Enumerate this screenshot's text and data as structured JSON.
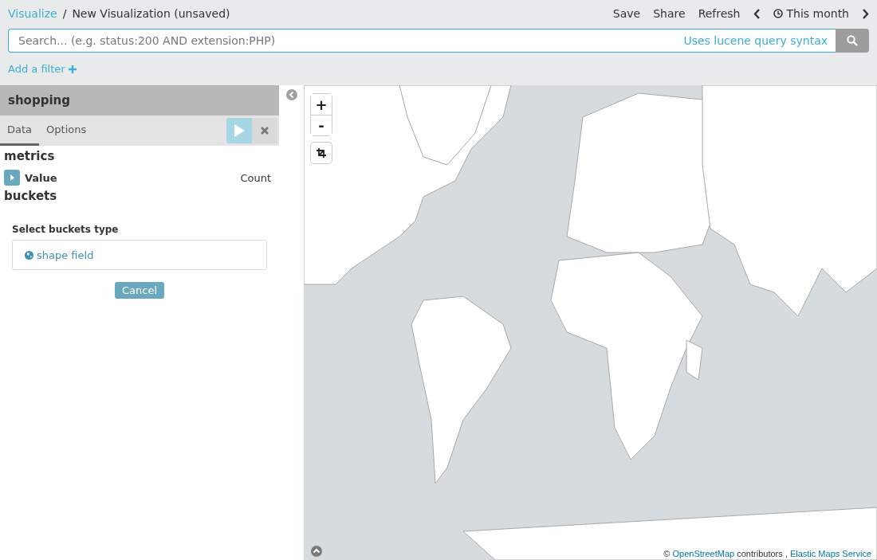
{
  "breadcrumb": {
    "parent": "Visualize",
    "separator": "/",
    "current": "New Visualization (unsaved)"
  },
  "nav_items": [
    "Save",
    "Share",
    "Refresh"
  ],
  "time_picker": {
    "label": "This month"
  },
  "search": {
    "placeholder": "Search... (e.g. status:200 AND extension:PHP)",
    "hint": "Uses lucene query syntax"
  },
  "add_filter": "Add a filter",
  "panel": {
    "title": "shopping",
    "tabs": [
      {
        "label": "Data",
        "selected": true
      },
      {
        "label": "Options",
        "selected": false
      }
    ],
    "metrics_heading": "metrics",
    "metrics": [
      {
        "label": "Value",
        "value": "Count",
        "expanded": false
      }
    ],
    "buckets_heading": "buckets",
    "select_label": "Select buckets type",
    "options": [
      "shape field"
    ],
    "cancel": "Cancel"
  },
  "map": {
    "kind": "picture",
    "zoom_in": "+",
    "zoom_out": "-",
    "attribution": {
      "prefix": "©",
      "links": [
        "OpenStreetMap",
        "Elastic Maps Service"
      ],
      "middle": "contributors ,"
    }
  }
}
